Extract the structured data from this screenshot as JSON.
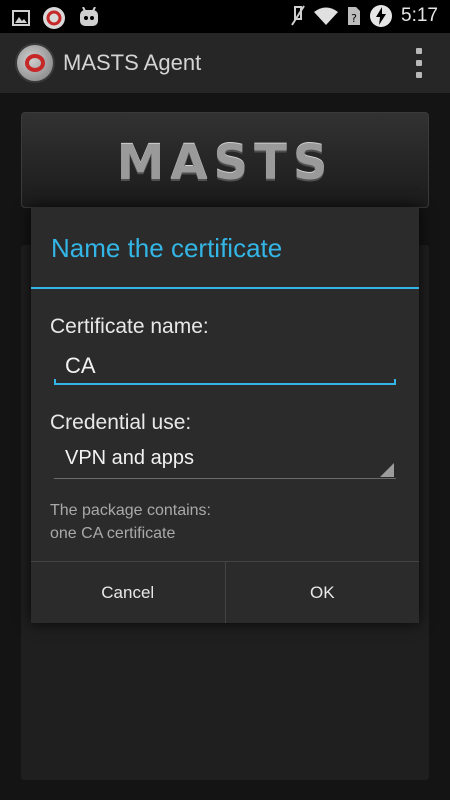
{
  "status_bar": {
    "time": "5:17",
    "icons": [
      "image-icon",
      "app-notification-icon",
      "android-icon",
      "mute-icon",
      "wifi-icon",
      "no-sim-icon",
      "battery-charging-icon"
    ]
  },
  "app_bar": {
    "title": "MASTS Agent",
    "overflow": "more-vert-icon"
  },
  "banner": {
    "logo_text": "MASTS"
  },
  "dialog": {
    "title": "Name the certificate",
    "name_label": "Certificate name:",
    "name_value": "CA",
    "credential_label": "Credential use:",
    "credential_value": "VPN and apps",
    "info_line1": "The package contains:",
    "info_line2": "one CA certificate",
    "cancel_label": "Cancel",
    "ok_label": "OK"
  },
  "colors": {
    "accent": "#33b5e5",
    "dialog_bg": "#2b2b2b",
    "app_bar_bg": "#262626"
  }
}
